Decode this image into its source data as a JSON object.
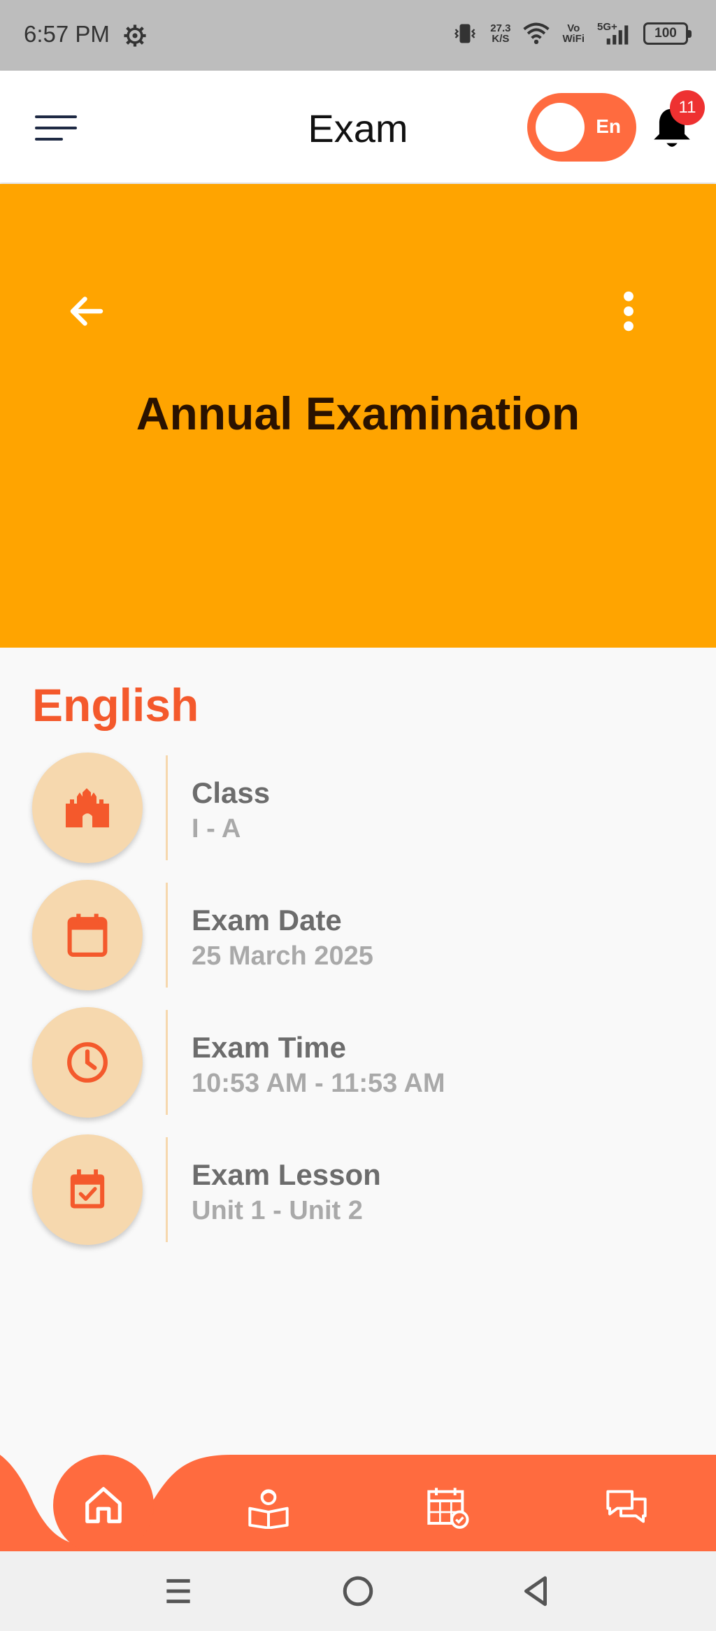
{
  "status_bar": {
    "time": "6:57 PM",
    "network_speed_value": "27.3",
    "network_speed_unit": "K/S",
    "vowifi_line1": "Vo",
    "vowifi_line2": "WiFi",
    "network_type": "5G+",
    "battery": "100"
  },
  "header": {
    "title": "Exam",
    "language_toggle": "En",
    "notification_count": "11"
  },
  "banner": {
    "title": "Annual Examination"
  },
  "subject": "English",
  "details": [
    {
      "label": "Class",
      "value": " I - A",
      "icon": "building-icon"
    },
    {
      "label": "Exam Date",
      "value": "25 March 2025",
      "icon": "calendar-icon"
    },
    {
      "label": "Exam Time",
      "value": "10:53 AM - 11:53 AM",
      "icon": "clock-icon"
    },
    {
      "label": "Exam Lesson",
      "value": "Unit 1 - Unit 2",
      "icon": "calendar-check-icon"
    }
  ],
  "colors": {
    "accent": "#ff6b3f",
    "banner": "#ffa400",
    "subject": "#f4592c",
    "icon_bg": "#f6d8ae"
  }
}
